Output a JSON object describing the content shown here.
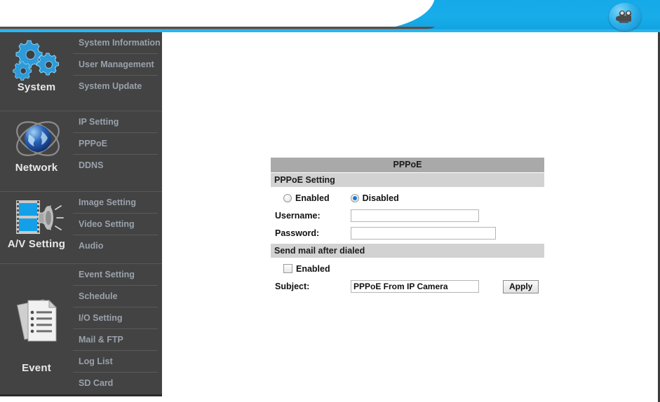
{
  "header": {
    "camera_icon": "video-camera-icon"
  },
  "sidebar": {
    "groups": [
      {
        "label": "System",
        "icon": "gears-icon",
        "items": [
          "System Information",
          "User Management",
          "System Update"
        ]
      },
      {
        "label": "Network",
        "icon": "globe-network-icon",
        "items": [
          "IP Setting",
          "PPPoE",
          "DDNS"
        ]
      },
      {
        "label": "A/V Setting",
        "icon": "film-speaker-icon",
        "items": [
          "Image Setting",
          "Video Setting",
          "Audio"
        ]
      },
      {
        "label": "Event",
        "icon": "documents-checklist-icon",
        "items": [
          "Event Setting",
          "Schedule",
          "I/O Setting",
          "Mail & FTP",
          "Log List",
          "SD Card"
        ]
      }
    ]
  },
  "main": {
    "card_title": "PPPoE",
    "sections": {
      "pppoe_setting": "PPPoE Setting",
      "send_mail": "Send mail after dialed"
    },
    "pppoe": {
      "enabled_label": "Enabled",
      "disabled_label": "Disabled",
      "selected": "Disabled",
      "username_label": "Username:",
      "username_value": "",
      "password_label": "Password:",
      "password_value": ""
    },
    "mail": {
      "enabled_label": "Enabled",
      "enabled_checked": false,
      "subject_label": "Subject:",
      "subject_value": "PPPoE From IP Camera"
    },
    "apply_label": "Apply"
  },
  "colors": {
    "banner_blue": "#18ace9",
    "cyan_line": "#29b6ef",
    "sidebar_bg": "#434343",
    "nav_text": "#9aa2ab",
    "card_title_bg": "#a9a9a9",
    "card_section_bg": "#d2d2d2",
    "radio_selected": "#1878d0"
  }
}
